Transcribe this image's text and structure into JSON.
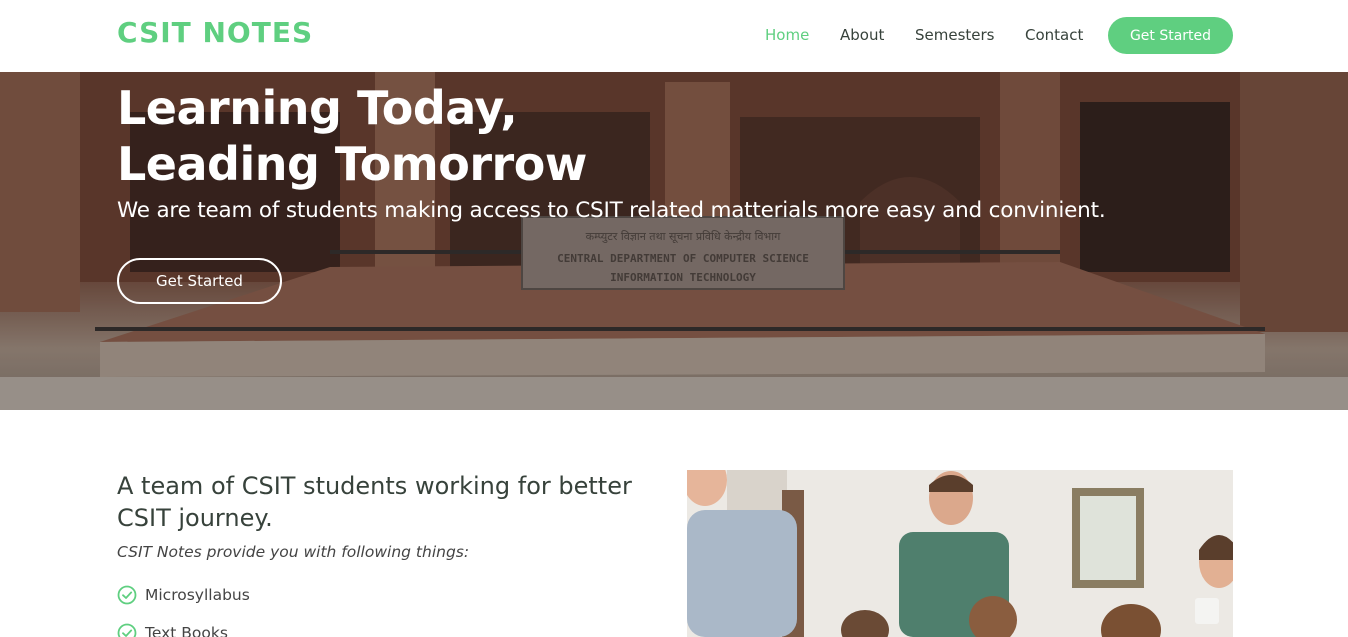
{
  "header": {
    "logo": "CSIT NOTES",
    "nav": [
      {
        "label": "Home",
        "active": true
      },
      {
        "label": "About",
        "active": false
      },
      {
        "label": "Semesters",
        "active": false
      },
      {
        "label": "Contact",
        "active": false
      }
    ],
    "cta_label": "Get Started"
  },
  "hero": {
    "title_line1": "Learning Today,",
    "title_line2": "Leading Tomorrow",
    "subtitle": "We are team of students making access to CSIT related matterials more easy and convinient.",
    "button_label": "Get Started",
    "sign_line1": "कम्प्युटर विज्ञान तथा सूचना प्रविधि केन्द्रीय विभाग",
    "sign_line2": "CENTRAL DEPARTMENT OF COMPUTER SCIENCE",
    "sign_line3": "INFORMATION TECHNOLOGY"
  },
  "about": {
    "title": "A team of CSIT students working for better CSIT journey.",
    "lead": "CSIT Notes provide you with following things:",
    "items": [
      "Microsyllabus",
      "Text Books"
    ]
  },
  "colors": {
    "accent": "#5fcf80",
    "heading": "#37423b",
    "text": "#444444"
  },
  "icons": {
    "check": "check-circle-icon"
  }
}
